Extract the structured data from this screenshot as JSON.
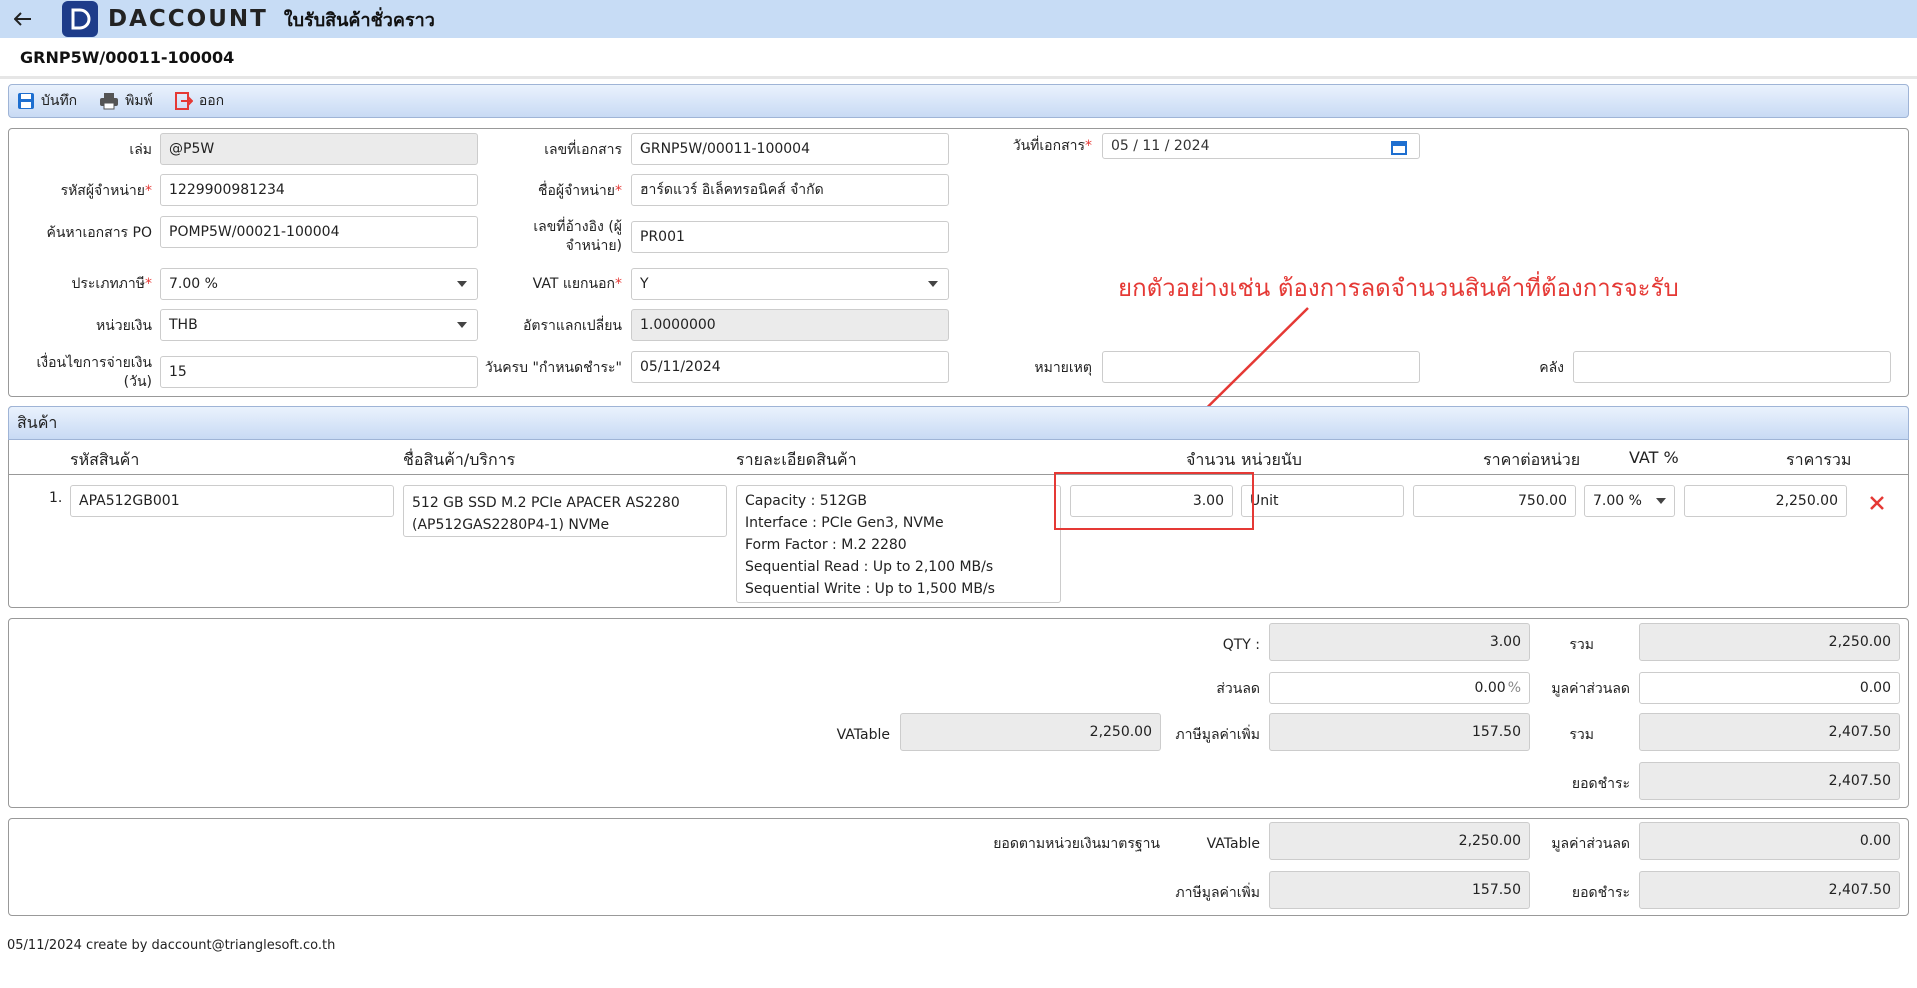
{
  "header": {
    "app_title": "ใบรับสินค้าชั่วคราว",
    "brand": "DACCOUNT"
  },
  "doc_number": "GRNP5W/00011-100004",
  "toolbar": {
    "save_label": "บันทึก",
    "print_label": "พิมพ์",
    "exit_label": "ออก"
  },
  "form": {
    "book_label": "เล่ม",
    "book_value": "@P5W",
    "doc_no_label": "เลขที่เอกสาร",
    "doc_no_value": "GRNP5W/00011-100004",
    "doc_date_label": "วันที่เอกสาร",
    "doc_date_value": "05 / 11 /  2024",
    "vendor_code_label": "รหัสผู้จำหน่าย",
    "vendor_code_value": "1229900981234",
    "vendor_name_label": "ชื่อผู้จำหน่าย",
    "vendor_name_value": "ฮาร์ดแวร์ อิเล็คทรอนิคส์ จำกัด",
    "po_label": "ค้นหาเอกสาร PO",
    "po_value": "POMP5W/00021-100004",
    "ref_label_1": "เลขที่อ้างอิง (ผู้",
    "ref_label_2": "จำหน่าย)",
    "ref_value": "PR001",
    "tax_type_label": "ประเภทภาษี",
    "tax_type_value": "7.00 %",
    "vat_sep_label": "VAT แยกนอก",
    "vat_sep_value": "Y",
    "currency_label": "หน่วยเงิน",
    "currency_value": "THB",
    "rate_label": "อัตราแลกเปลี่ยน",
    "rate_value": "1.0000000",
    "terms_label_1": "เงื่อนไขการจ่ายเงิน",
    "terms_label_2": "(วัน)",
    "terms_value": "15",
    "due_label": "วันครบ \"กำหนดชำระ\"",
    "due_value": "05/11/2024",
    "remark_label": "หมายเหตุ",
    "remark_value": "",
    "warehouse_label": "คลัง",
    "warehouse_value": ""
  },
  "annotation": "ยกตัวอย่างเช่น ต้องการลดจำนวนสินค้าที่ต้องการจะรับ",
  "products": {
    "section_title": "สินค้า",
    "columns": [
      "รหัสสินค้า",
      "ชื่อสินค้า/บริการ",
      "รายละเอียดสินค้า",
      "จำนวน",
      "หน่วยนับ",
      "ราคาต่อหน่วย",
      "VAT %",
      "ราคารวม"
    ],
    "rows": [
      {
        "no": "1.",
        "code": "APA512GB001",
        "name_1": "512 GB SSD M.2 PCIe APACER AS2280",
        "name_2": "(AP512GAS2280P4-1) NVMe",
        "detail": [
          "Capacity : 512GB",
          "Interface : PCIe Gen3, NVMe",
          "Form Factor : M.2 2280",
          "Sequential Read : Up to 2,100 MB/s",
          "Sequential Write : Up to 1,500 MB/s"
        ],
        "qty": "3.00",
        "unit": "Unit",
        "price": "750.00",
        "vat": "7.00 %",
        "total": "2,250.00"
      }
    ]
  },
  "summary": {
    "qty_label": "QTY :",
    "qty_value": "3.00",
    "sum_label": "รวม",
    "sum_value": "2,250.00",
    "discount_label": "ส่วนลด",
    "discount_value": "0.00",
    "discount_unit": "%",
    "discount_amt_label": "มูลค่าส่วนลด",
    "discount_amt_value": "0.00",
    "vatable_label": "VATable",
    "vatable_value": "2,250.00",
    "vat_label": "ภาษีมูลค่าเพิ่ม",
    "vat_value": "157.50",
    "total_label": "รวม",
    "total_value": "2,407.50",
    "pay_label": "ยอดชำระ",
    "pay_value": "2,407.50"
  },
  "base_currency": {
    "title": "ยอดตามหน่วยเงินมาตรฐาน",
    "vatable_label": "VATable",
    "vatable_value": "2,250.00",
    "discount_amt_label": "มูลค่าส่วนลด",
    "discount_amt_value": "0.00",
    "vat_label": "ภาษีมูลค่าเพิ่ม",
    "vat_value": "157.50",
    "pay_label": "ยอดชำระ",
    "pay_value": "2,407.50"
  },
  "footer": "05/11/2024 create by daccount@trianglesoft.co.th",
  "colors": {
    "topbar": "#c7dcf5",
    "accent_red": "#e53935",
    "brand_blue": "#1d3c8a"
  }
}
